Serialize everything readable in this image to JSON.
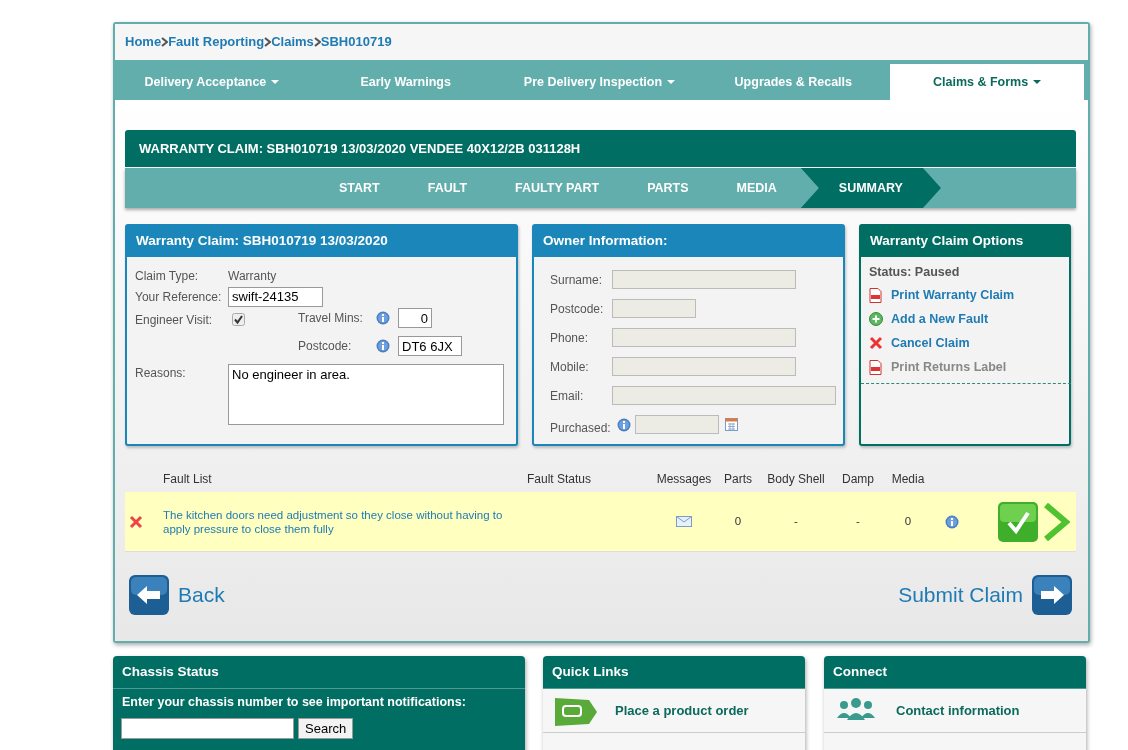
{
  "breadcrumb": [
    {
      "label": "Home"
    },
    {
      "label": "Fault Reporting"
    },
    {
      "label": "Claims"
    },
    {
      "label": "SBH010719"
    }
  ],
  "nav_tabs": [
    {
      "label": "Delivery Acceptance",
      "dropdown": true,
      "selected": false
    },
    {
      "label": "Early Warnings",
      "dropdown": false,
      "selected": false
    },
    {
      "label": "Pre Delivery Inspection",
      "dropdown": true,
      "selected": false
    },
    {
      "label": "Upgrades & Recalls",
      "dropdown": false,
      "selected": false
    },
    {
      "label": "Claims & Forms",
      "dropdown": true,
      "selected": true
    }
  ],
  "claim_header": {
    "title": "WARRANTY CLAIM: SBH010719 13/03/2020 VENDEE 40X12/2B 031128H"
  },
  "steps": [
    {
      "label": "START",
      "selected": false
    },
    {
      "label": "FAULT",
      "selected": false
    },
    {
      "label": "FAULTY PART",
      "selected": false
    },
    {
      "label": "PARTS",
      "selected": false
    },
    {
      "label": "MEDIA",
      "selected": false
    },
    {
      "label": "SUMMARY",
      "selected": true
    }
  ],
  "claim_panel": {
    "title": "Warranty Claim: SBH010719 13/03/2020",
    "claim_type_label": "Claim Type:",
    "claim_type": "Warranty",
    "reference_label": "Your Reference:",
    "reference": "swift-24135",
    "engineer_visit_label": "Engineer Visit:",
    "engineer_visit": true,
    "travel_mins_label": "Travel Mins:",
    "travel_mins": "0",
    "postcode_label": "Postcode:",
    "postcode": "DT6 6JX",
    "reasons_label": "Reasons:",
    "reasons": "No engineer in area."
  },
  "owner_panel": {
    "title": "Owner Information:",
    "fields": [
      {
        "label": "Surname:",
        "kind": "text"
      },
      {
        "label": "Postcode:",
        "kind": "text"
      },
      {
        "label": "Phone:",
        "kind": "text"
      },
      {
        "label": "Mobile:",
        "kind": "text"
      },
      {
        "label": "Email:",
        "kind": "text"
      },
      {
        "label": "Purchased:",
        "kind": "date"
      }
    ]
  },
  "options_panel": {
    "title": "Warranty Claim Options",
    "status": "Status: Paused",
    "actions": [
      {
        "label": "Print Warranty Claim",
        "kind": "pdf",
        "disabled": false
      },
      {
        "label": "Add a New Fault",
        "kind": "add",
        "disabled": false
      },
      {
        "label": "Cancel Claim",
        "kind": "cancel",
        "disabled": false
      },
      {
        "label": "Print Returns Label",
        "kind": "pdf",
        "disabled": true
      }
    ]
  },
  "fault_table": {
    "columns": [
      "Fault List",
      "Fault Status",
      "Messages",
      "Parts",
      "Body Shell",
      "Damp",
      "Media"
    ],
    "rows": [
      {
        "description": "The kitchen doors need adjustment so they close without having to apply pressure to close them fully",
        "parts": "0",
        "body_shell": "-",
        "damp": "-",
        "media": "0"
      }
    ]
  },
  "back_button": "Back",
  "submit_button": "Submit Claim",
  "chassis_status": {
    "title": "Chassis Status",
    "prompt": "Enter your chassis number to see important notifications:",
    "button": "Search"
  },
  "quick_links": {
    "title": "Quick Links",
    "items": [
      {
        "label": "Place a product order",
        "kind": "caravan"
      }
    ]
  },
  "connect": {
    "title": "Connect",
    "items": [
      {
        "label": "Contact information",
        "kind": "people"
      }
    ]
  }
}
